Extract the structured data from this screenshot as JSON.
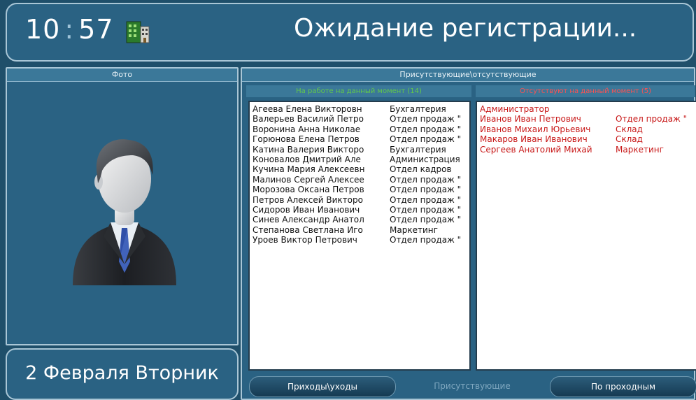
{
  "header": {
    "time_hours": "10",
    "time_sep": ":",
    "time_minutes": "57",
    "status_title": "Ожидание регистрации..."
  },
  "photo_panel": {
    "title": "Фото"
  },
  "date_panel": {
    "date": "2 Февраля Вторник"
  },
  "presence": {
    "title": "Присутствующие\\отсутствующие",
    "present_header": "На работе на данный момент (14)",
    "absent_header": "Отсутствуют на данный момент (5)",
    "present": [
      {
        "name": "Агеева Елена Викторовн",
        "dept": "Бухгалтерия"
      },
      {
        "name": "Валерьев Василий Петро",
        "dept": "Отдел продаж \""
      },
      {
        "name": "Воронина Анна Николае",
        "dept": "Отдел продаж \""
      },
      {
        "name": "Горюнова Елена Петров",
        "dept": "Отдел продаж \""
      },
      {
        "name": "Катина Валерия Викторо",
        "dept": "Бухгалтерия"
      },
      {
        "name": "Коновалов Дмитрий Але",
        "dept": "Администрация"
      },
      {
        "name": "Кучина Мария Алексеевн",
        "dept": "Отдел кадров"
      },
      {
        "name": "Малинов Сергей Алексее",
        "dept": "Отдел продаж \""
      },
      {
        "name": "Морозова Оксана Петров",
        "dept": "Отдел продаж \""
      },
      {
        "name": "Петров Алексей Викторо",
        "dept": "Отдел продаж \""
      },
      {
        "name": "Сидоров Иван Иванович",
        "dept": "Отдел продаж \""
      },
      {
        "name": "Синев Александр Анатол",
        "dept": "Отдел продаж \""
      },
      {
        "name": "Степанова Светлана Иго",
        "dept": "Маркетинг"
      },
      {
        "name": "Уроев Виктор Петрович",
        "dept": "Отдел продаж \""
      }
    ],
    "absent": [
      {
        "name": "Администратор",
        "dept": ""
      },
      {
        "name": "Иванов Иван Петрович",
        "dept": "Отдел продаж \""
      },
      {
        "name": "Иванов Михаил Юрьевич",
        "dept": "Склад"
      },
      {
        "name": "Макаров Иван Иванович",
        "dept": "Склад"
      },
      {
        "name": "Сергеев Анатолий Михай",
        "dept": "Маркетинг"
      }
    ]
  },
  "tabs": [
    {
      "label": "Приходы\\уходы",
      "state": "active"
    },
    {
      "label": "Присутствующие",
      "state": "disabled"
    },
    {
      "label": "По проходным",
      "state": "active"
    }
  ],
  "colors": {
    "background": "#1f4f6a",
    "panel": "#2a6283",
    "present_header": "#63c94b",
    "absent_header": "#ff5151",
    "absent_text": "#c81818"
  },
  "icons": {
    "status": "building-icon",
    "photo": "person-avatar"
  }
}
